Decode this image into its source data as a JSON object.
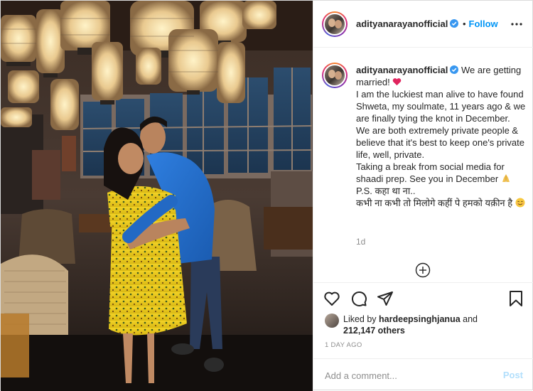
{
  "post": {
    "username": "adityanarayanofficial",
    "follow_label": "Follow",
    "separator": "•",
    "verified_color": "#3897f0",
    "accent_color": "#0095f6"
  },
  "caption": {
    "username": "adityanarayanofficial",
    "lines": [
      "We are getting married!",
      "I am the luckiest man alive to have found Shweta, my soulmate, 11 years ago & we are finally tying the knot in December.",
      "We are both extremely private people & believe that it's best to keep one's private life, well, private.",
      "Taking a break from social media for shaadi prep. See you in December",
      "P.S. कहा था ना..",
      "कभी ना कभी तो मिलोगे कहीं पे हमको यक़ीन है"
    ],
    "emojis": [
      "red-heart",
      "folded-hands",
      "smiling-face"
    ],
    "time_ago": "1d"
  },
  "likes": {
    "prefix": "Liked by",
    "user": "hardeepsinghjanua",
    "and": "and",
    "others": "212,147 others"
  },
  "date": "1 DAY AGO",
  "comment": {
    "placeholder": "Add a comment...",
    "post_label": "Post",
    "post_color": "#b2dffc"
  },
  "icons": {
    "header": [
      "verified-badge-icon",
      "more-options-icon"
    ],
    "actions": [
      "heart-icon",
      "comment-icon",
      "share-icon",
      "save-icon"
    ],
    "load_more": "plus-circle-icon"
  }
}
